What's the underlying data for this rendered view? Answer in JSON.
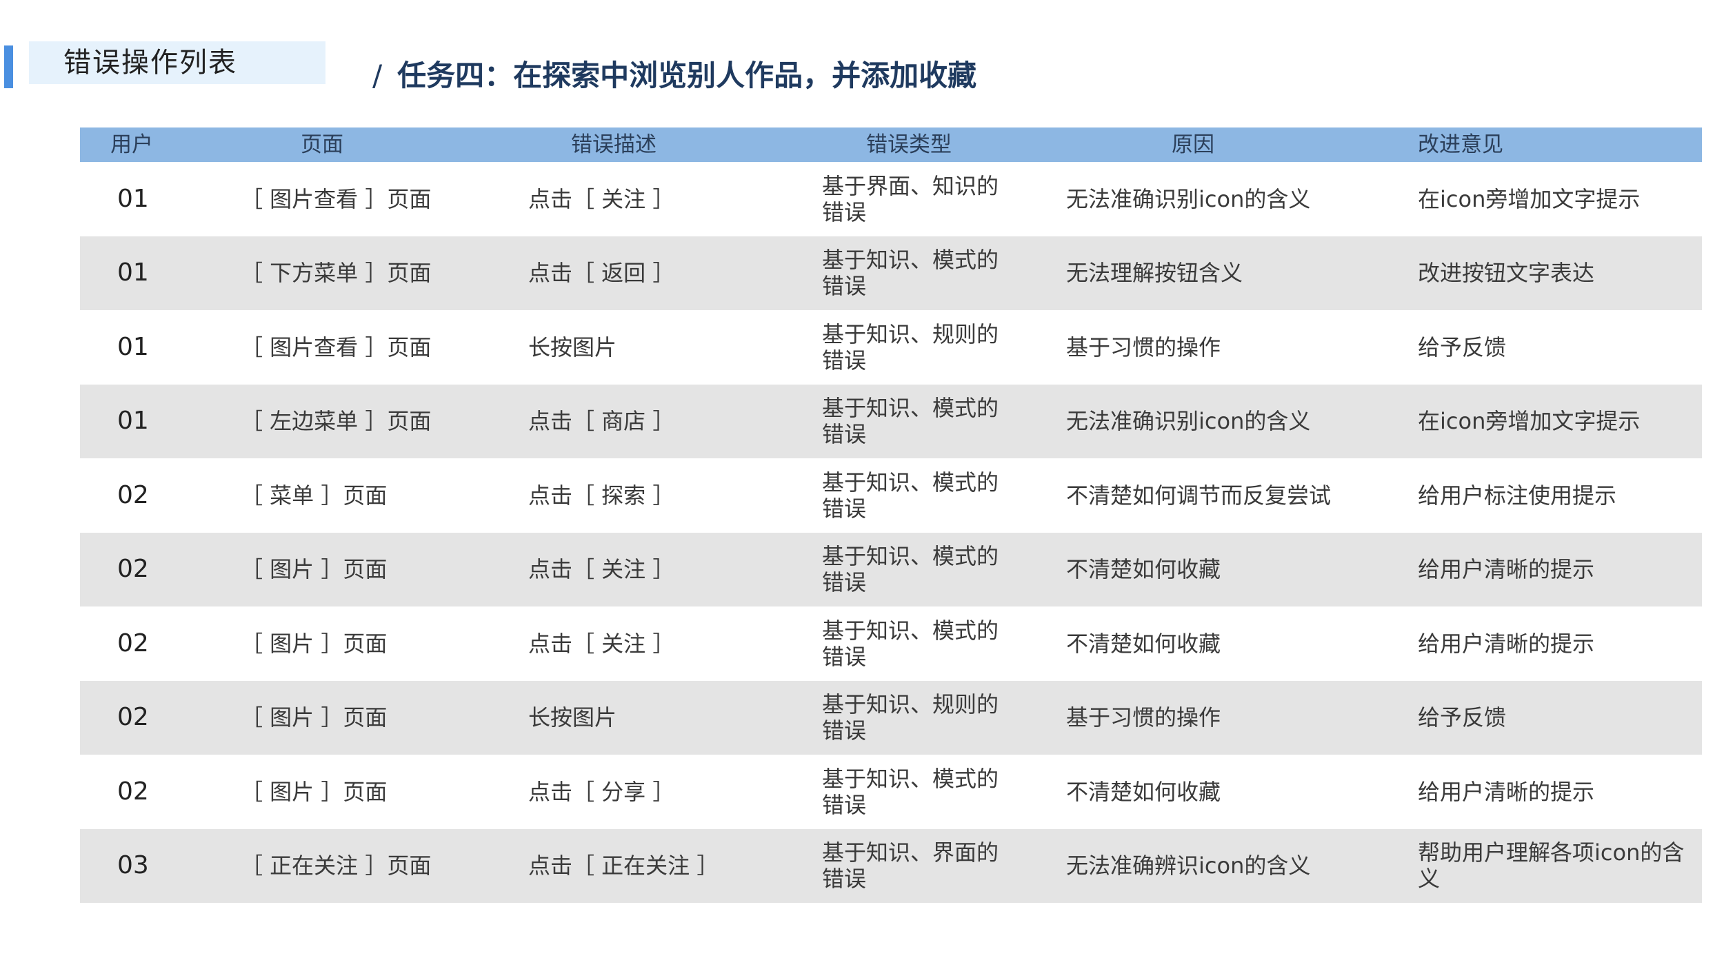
{
  "section_tag": "错误操作列表",
  "task": {
    "slash": "/",
    "title": "任务四：在探索中浏览别人作品，并添加收藏"
  },
  "table": {
    "headers": [
      "用户",
      "页面",
      "错误描述",
      "错误类型",
      "原因",
      "改进意见"
    ],
    "rows": [
      [
        "01",
        "［ 图片查看 ］页面",
        "点击［ 关注 ］",
        "基于界面、知识的错误",
        "无法准确识别icon的含义",
        "在icon旁增加文字提示"
      ],
      [
        "01",
        "［ 下方菜单 ］页面",
        "点击［ 返回 ］",
        "基于知识、模式的错误",
        "无法理解按钮含义",
        "改进按钮文字表达"
      ],
      [
        "01",
        "［ 图片查看 ］页面",
        "长按图片",
        "基于知识、规则的错误",
        "基于习惯的操作",
        "给予反馈"
      ],
      [
        "01",
        "［ 左边菜单 ］页面",
        "点击［ 商店 ］",
        "基于知识、模式的错误",
        "无法准确识别icon的含义",
        "在icon旁增加文字提示"
      ],
      [
        "02",
        "［ 菜单 ］页面",
        "点击［ 探索 ］",
        "基于知识、模式的错误",
        "不清楚如何调节而反复尝试",
        "给用户标注使用提示"
      ],
      [
        "02",
        "［ 图片 ］页面",
        "点击［ 关注 ］",
        "基于知识、模式的错误",
        "不清楚如何收藏",
        "给用户清晰的提示"
      ],
      [
        "02",
        "［ 图片 ］页面",
        "点击［ 关注 ］",
        "基于知识、模式的错误",
        "不清楚如何收藏",
        "给用户清晰的提示"
      ],
      [
        "02",
        "［ 图片 ］页面",
        "长按图片",
        "基于知识、规则的错误",
        "基于习惯的操作",
        "给予反馈"
      ],
      [
        "02",
        "［ 图片 ］页面",
        "点击［ 分享 ］",
        "基于知识、模式的错误",
        "不清楚如何收藏",
        "给用户清晰的提示"
      ],
      [
        "03",
        "［ 正在关注 ］页面",
        "点击［ 正在关注 ］",
        "基于知识、界面的错误",
        "无法准确辨识icon的含义",
        "帮助用户理解各项icon的含义"
      ]
    ]
  }
}
